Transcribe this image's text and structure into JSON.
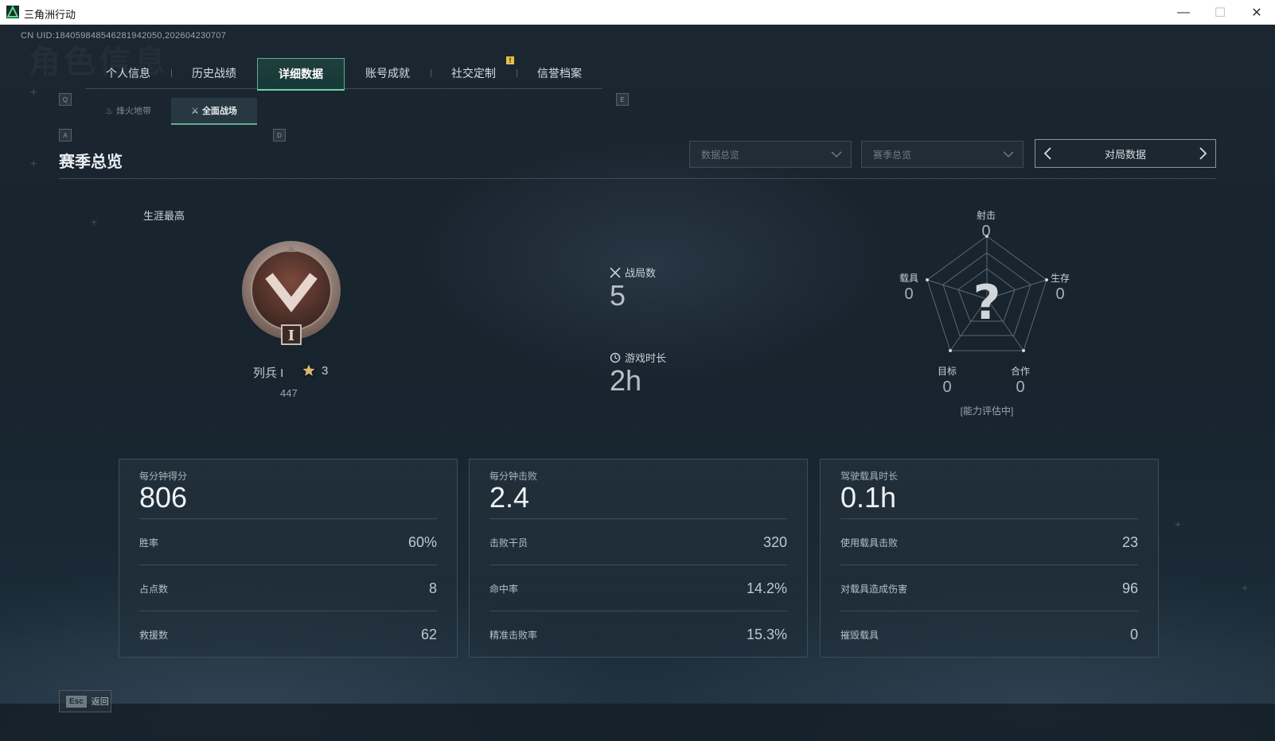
{
  "window": {
    "title": "三角洲行动",
    "minimize": "—",
    "maximize": "☐",
    "close": "✕"
  },
  "uid": "CN UID:184059848546281942050,202604230707",
  "ghost_title": "角色信息",
  "keys": {
    "q": "Q",
    "e": "E",
    "a": "A",
    "d": "D"
  },
  "tabs": [
    {
      "label": "个人信息"
    },
    {
      "label": "历史战绩"
    },
    {
      "label": "详细数据",
      "active": true
    },
    {
      "label": "账号成就"
    },
    {
      "label": "社交定制"
    },
    {
      "label": "信誉档案"
    }
  ],
  "notify_badge": "!",
  "subtabs": [
    {
      "label": "烽火地带",
      "icon": "flame-icon"
    },
    {
      "label": "全面战场",
      "icon": "battle-icon",
      "active": true
    }
  ],
  "section": {
    "title": "赛季总览",
    "dropdown1": "数据总览",
    "dropdown2": "赛季总览",
    "pager": "对局数据"
  },
  "career": {
    "label": "生涯最高",
    "rank_name": "列兵 I",
    "stars": "3",
    "points": "447",
    "badge_numeral": "I"
  },
  "mid": {
    "matches_label": "战局数",
    "matches_value": "5",
    "time_label": "游戏时长",
    "time_value": "2h"
  },
  "radar": {
    "center": "?",
    "status": "[能力评估中]",
    "axes": [
      {
        "label": "射击",
        "value": "0"
      },
      {
        "label": "生存",
        "value": "0"
      },
      {
        "label": "合作",
        "value": "0"
      },
      {
        "label": "目标",
        "value": "0"
      },
      {
        "label": "载具",
        "value": "0"
      }
    ]
  },
  "cards": [
    {
      "title": "每分钟得分",
      "value": "806",
      "rows": [
        {
          "label": "胜率",
          "value": "60%"
        },
        {
          "label": "占点数",
          "value": "8"
        },
        {
          "label": "救援数",
          "value": "62"
        }
      ]
    },
    {
      "title": "每分钟击败",
      "value": "2.4",
      "rows": [
        {
          "label": "击败干员",
          "value": "320"
        },
        {
          "label": "命中率",
          "value": "14.2%"
        },
        {
          "label": "精准击败率",
          "value": "15.3%"
        }
      ]
    },
    {
      "title": "驾驶载具时长",
      "value": "0.1h",
      "rows": [
        {
          "label": "使用载具击败",
          "value": "23"
        },
        {
          "label": "对载具造成伤害",
          "value": "96"
        },
        {
          "label": "摧毁载具",
          "value": "0"
        }
      ]
    }
  ],
  "footer": {
    "esc_key": "Esc",
    "esc_label": "返回"
  },
  "colors": {
    "accent": "#5fae92",
    "highlight": "#6fd3a8",
    "badge_yellow": "#e7c04a",
    "bg_dark": "#17232d"
  }
}
